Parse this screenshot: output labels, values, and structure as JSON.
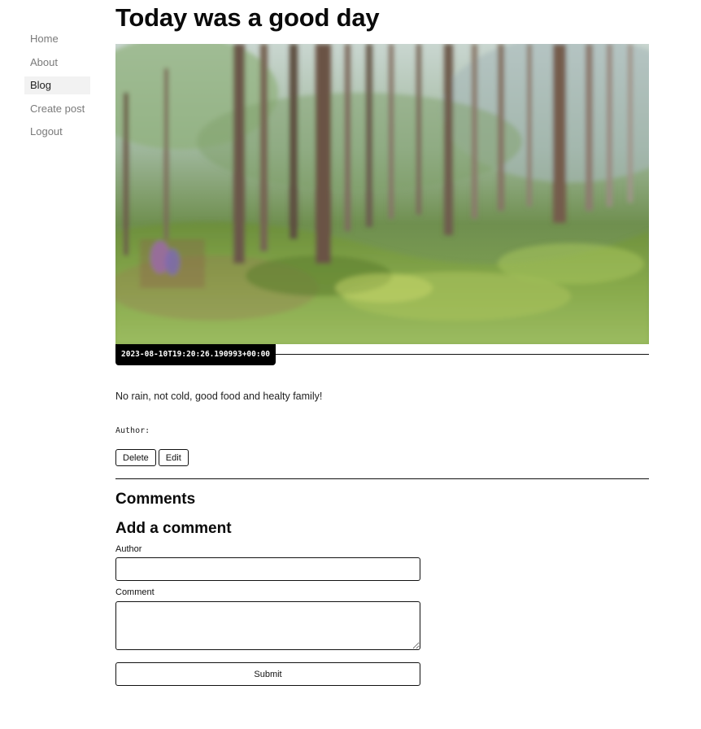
{
  "nav": {
    "items": [
      {
        "label": "Home"
      },
      {
        "label": "About"
      },
      {
        "label": "Blog"
      },
      {
        "label": "Create post"
      },
      {
        "label": "Logout"
      }
    ]
  },
  "post": {
    "title": "Today was a good day",
    "date": "2023-08-10T19:20:26.190993+00:00",
    "body": "No rain, not cold, good food and healty family!",
    "author_label": "Author:",
    "delete_label": "Delete",
    "edit_label": "Edit"
  },
  "comments": {
    "heading": "Comments",
    "add_heading": "Add a comment",
    "author_label": "Author",
    "comment_label": "Comment",
    "submit_label": "Submit"
  }
}
